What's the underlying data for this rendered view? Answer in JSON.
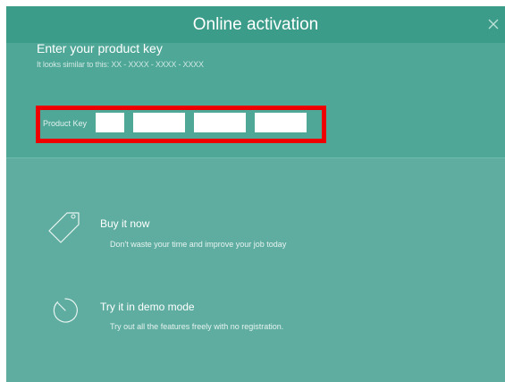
{
  "window": {
    "title": "Online activation",
    "close_icon": "close-icon"
  },
  "product_key": {
    "heading": "Enter your product key",
    "hint": "It looks similar to this: XX - XXXX - XXXX - XXXX",
    "label": "Product Key",
    "fields": [
      "",
      "",
      "",
      ""
    ]
  },
  "options": [
    {
      "icon": "tag-icon",
      "title": "Buy it now",
      "description": "Don't waste your time and improve your job today"
    },
    {
      "icon": "stopwatch-icon",
      "title": "Try it in demo mode",
      "description": "Try out all the features freely with no registration."
    }
  ],
  "colors": {
    "titlebar": "#3a9c89",
    "key_section": "#4ea797",
    "body": "#5fada0",
    "highlight_border": "#ee0000"
  }
}
